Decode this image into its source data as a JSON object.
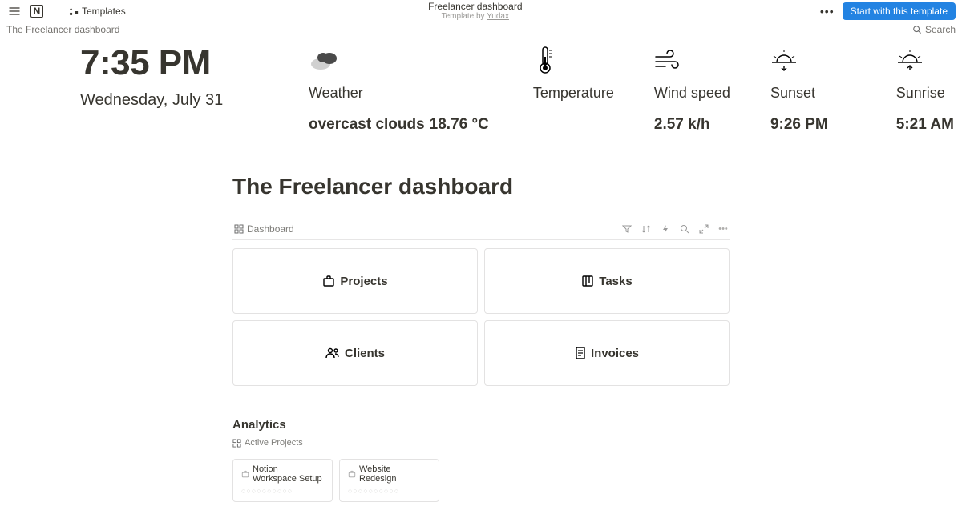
{
  "topbar": {
    "templates_label": "Templates",
    "title": "Freelancer dashboard",
    "subtitle_prefix": "Template by ",
    "author": "Yudax",
    "start_button": "Start with this template"
  },
  "breadcrumb": "The Freelancer dashboard",
  "search_label": "Search",
  "clock": {
    "time": "7:35 PM",
    "date": "Wednesday, July 31"
  },
  "weather": {
    "weather_label": "Weather",
    "weather_value": "overcast clouds",
    "temperature_label": "Temperature",
    "temperature_value": "18.76 °C",
    "wind_label": "Wind speed",
    "wind_value": "2.57 k/h",
    "sunset_label": "Sunset",
    "sunset_value": "9:26 PM",
    "sunrise_label": "Sunrise",
    "sunrise_value": "5:21 AM"
  },
  "main": {
    "title": "The Freelancer dashboard",
    "db_tab": "Dashboard",
    "cards": {
      "projects": "Projects",
      "tasks": "Tasks",
      "clients": "Clients",
      "invoices": "Invoices"
    },
    "analytics_title": "Analytics",
    "analytics_tab": "Active Projects",
    "projects": [
      {
        "name": "Notion Workspace Setup"
      },
      {
        "name": "Website Redesign"
      }
    ]
  }
}
